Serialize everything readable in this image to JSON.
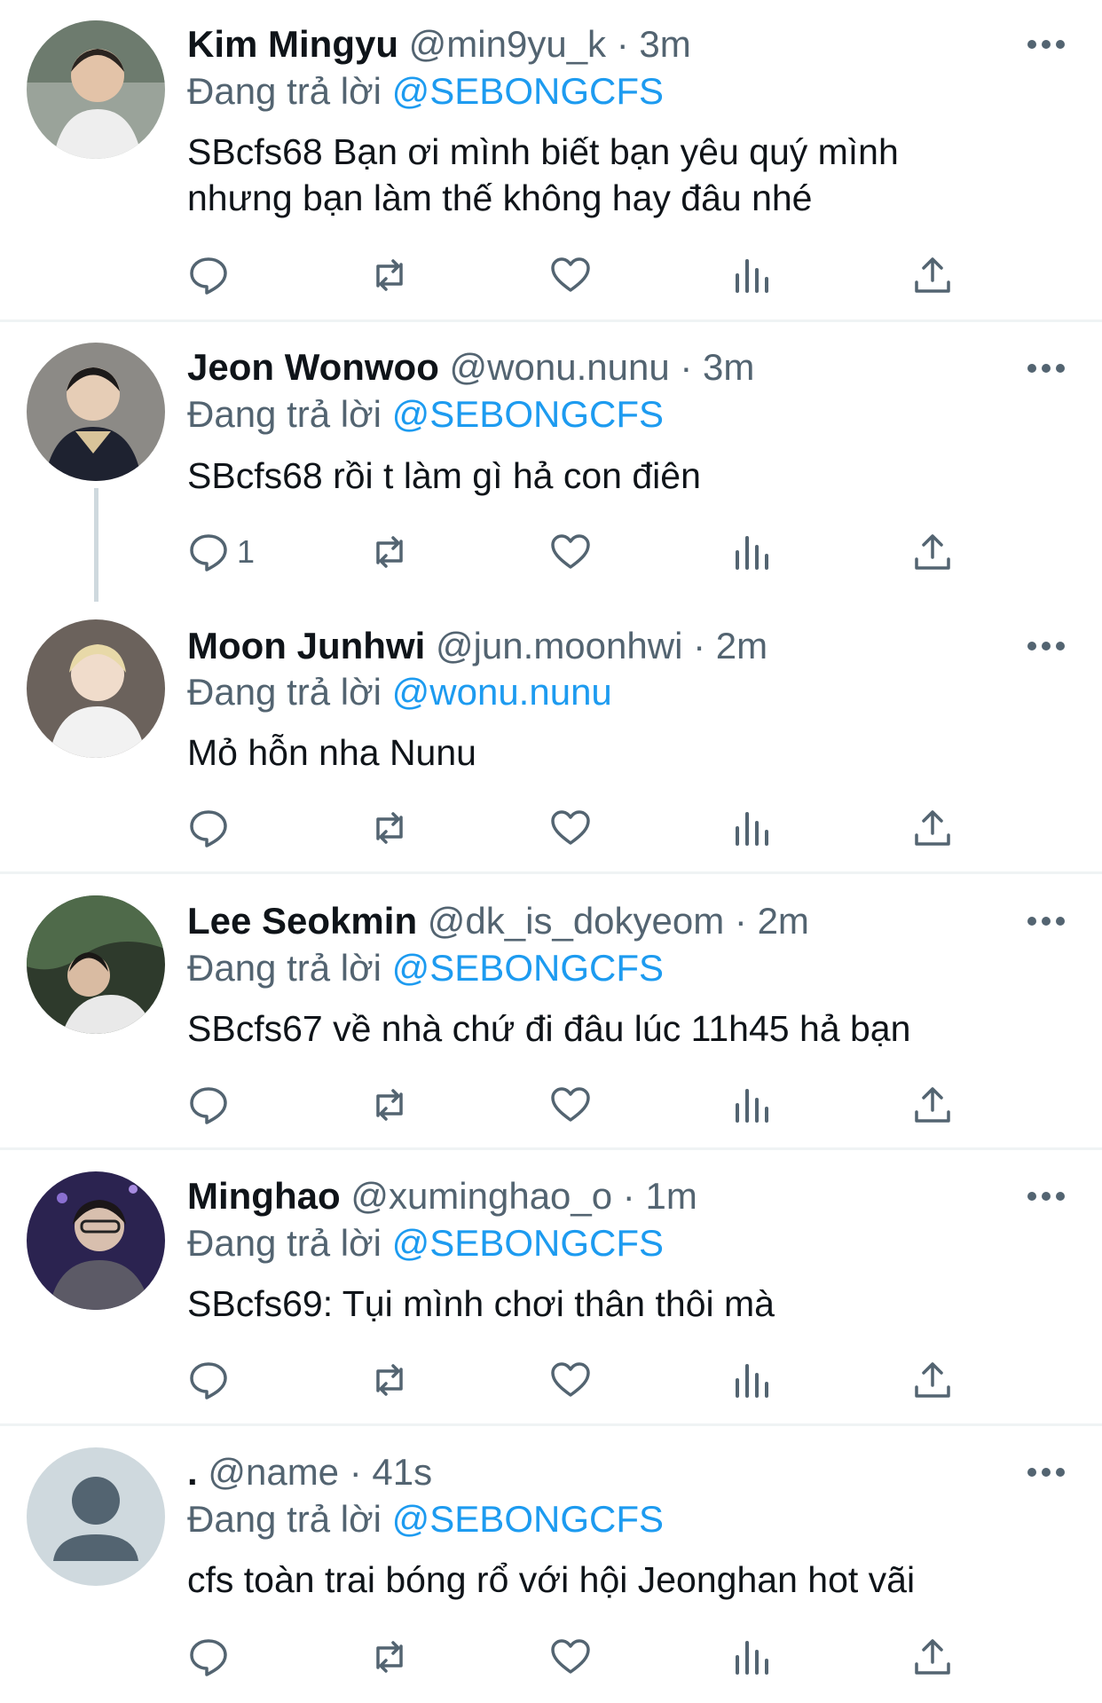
{
  "reply_prefix": "Đang trả lời",
  "colors": {
    "accent": "#1d9bf0",
    "secondary": "#536471",
    "text": "#0f1419",
    "divider": "#eff3f4"
  },
  "tweets": [
    {
      "name": "Kim Mingyu",
      "handle": "@min9yu_k · 3m",
      "reply_to": "@SEBONGCFS",
      "text": "SBcfs68 Bạn ơi mình biết bạn yêu quý mình nhưng bạn làm thế không hay đâu nhé",
      "reply_count": ""
    },
    {
      "name": "Jeon Wonwoo",
      "handle": "@wonu.nunu · 3m",
      "reply_to": "@SEBONGCFS",
      "text": "SBcfs68 rồi t làm gì hả con điên",
      "reply_count": "1"
    },
    {
      "name": "Moon Junhwi",
      "handle": "@jun.moonhwi · 2m",
      "reply_to": "@wonu.nunu",
      "text": "Mỏ hỗn nha Nunu",
      "reply_count": ""
    },
    {
      "name": "Lee Seokmin",
      "handle": "@dk_is_dokyeom · 2m",
      "reply_to": "@SEBONGCFS",
      "text": "SBcfs67 về nhà chứ đi đâu lúc 11h45 hả bạn",
      "reply_count": ""
    },
    {
      "name": "Minghao",
      "handle": "@xuminghao_o · 1m",
      "reply_to": "@SEBONGCFS",
      "text": "SBcfs69: Tụi mình chơi thân thôi mà",
      "reply_count": ""
    },
    {
      "name": ".",
      "handle": "@name · 41s",
      "reply_to": "@SEBONGCFS",
      "text": "cfs toàn trai bóng rổ với hội Jeonghan hot vãi",
      "reply_count": ""
    }
  ]
}
